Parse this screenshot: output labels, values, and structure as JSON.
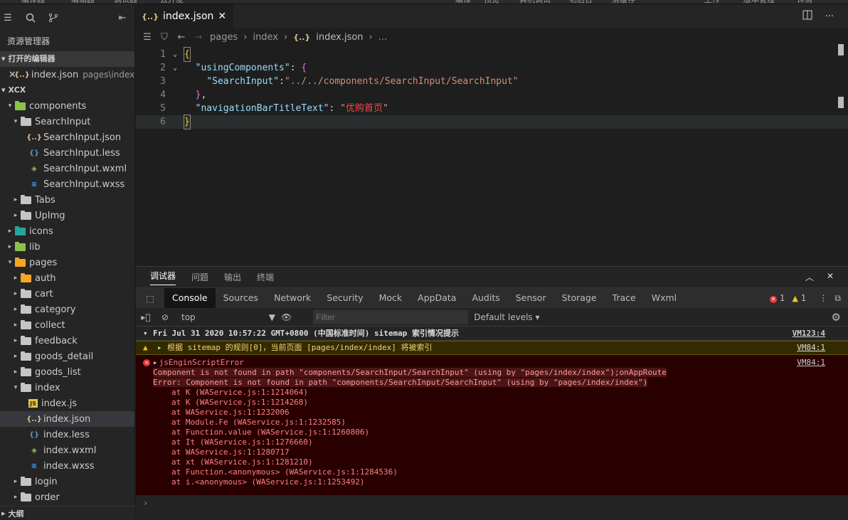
{
  "topstrip": {
    "items": [
      "编译器",
      "编辑器",
      "调试器",
      "云开发",
      "编译",
      "预览",
      "真机调试",
      "切后台",
      "清缓存",
      "上传",
      "版本管理",
      "详情"
    ]
  },
  "sidebar": {
    "title": "资源管理器",
    "open_editors_label": "打开的编辑器",
    "open_editor": {
      "name": "index.json",
      "path": "pages\\index"
    },
    "project_label": "XCX",
    "tree": [
      {
        "label": "components"
      },
      {
        "label": "SearchInput"
      },
      {
        "label": "SearchInput.json"
      },
      {
        "label": "SearchInput.less"
      },
      {
        "label": "SearchInput.wxml"
      },
      {
        "label": "SearchInput.wxss"
      },
      {
        "label": "Tabs"
      },
      {
        "label": "UpImg"
      },
      {
        "label": "icons"
      },
      {
        "label": "lib"
      },
      {
        "label": "pages"
      },
      {
        "label": "auth"
      },
      {
        "label": "cart"
      },
      {
        "label": "category"
      },
      {
        "label": "collect"
      },
      {
        "label": "feedback"
      },
      {
        "label": "goods_detail"
      },
      {
        "label": "goods_list"
      },
      {
        "label": "index"
      },
      {
        "label": "index.js"
      },
      {
        "label": "index.json"
      },
      {
        "label": "index.less"
      },
      {
        "label": "index.wxml"
      },
      {
        "label": "index.wxss"
      },
      {
        "label": "login"
      },
      {
        "label": "order"
      }
    ],
    "outline_label": "大纲"
  },
  "editor": {
    "tab": {
      "name": "index.json"
    },
    "breadcrumb": [
      "pages",
      "index",
      "index.json",
      "..."
    ],
    "code": {
      "key_components": "\"usingComponents\"",
      "key_search": "\"SearchInput\"",
      "val_search": "\"../../components/SearchInput/SearchInput\"",
      "key_title": "\"navigationBarTitleText\"",
      "val_title": "优购首页"
    }
  },
  "panel": {
    "tabs": [
      "调试器",
      "问题",
      "输出",
      "终端"
    ],
    "devtools_tabs": [
      "Console",
      "Sources",
      "Network",
      "Security",
      "Mock",
      "AppData",
      "Audits",
      "Sensor",
      "Storage",
      "Trace",
      "Wxml"
    ],
    "error_count": "1",
    "warn_count": "1",
    "context": "top",
    "filter_placeholder": "Filter",
    "levels": "Default levels",
    "console": {
      "group": {
        "text": "Fri Jul 31 2020 10:57:22 GMT+0800 (中国标准时间) sitemap 索引情况提示",
        "src": "VM123:4"
      },
      "warn": {
        "text": "根据 sitemap 的规则[0]，当前页面 [pages/index/index] 将被索引",
        "src": "VM84:1"
      },
      "error": {
        "title": "jsEnginScriptError",
        "src": "VM84:1",
        "line1": "Component is not found in path \"components/SearchInput/SearchInput\" (using by \"pages/index/index\");onAppRoute",
        "line2": "Error: Component is not found in path \"components/SearchInput/SearchInput\" (using by \"pages/index/index\")",
        "stack": [
          "at K (WAService.js:1:1214064)",
          "at K (WAService.js:1:1214268)",
          "at WAService.js:1:1232006",
          "at Module.Fe (WAService.js:1:1232585)",
          "at Function.value (WAService.js:1:1260806)",
          "at It (WAService.js:1:1276660)",
          "at WAService.js:1:1280717",
          "at xt (WAService.js:1:1281210)",
          "at Function.<anonymous> (WAService.js:1:1284536)",
          "at i.<anonymous> (WAService.js:1:1253492)"
        ]
      }
    }
  }
}
